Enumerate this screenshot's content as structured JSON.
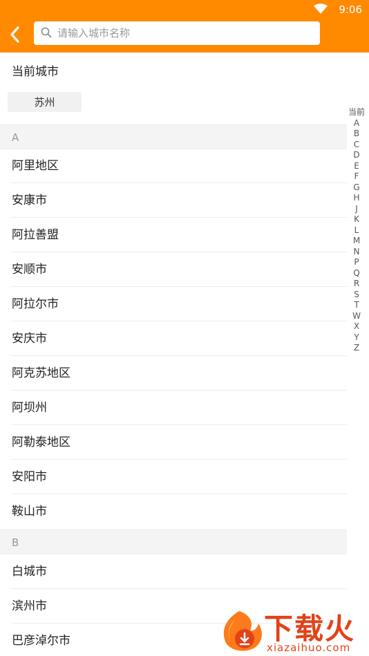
{
  "status_bar": {
    "time": "9:06",
    "wifi_icon": "wifi-icon"
  },
  "header": {
    "back_icon": "chevron-left-icon",
    "search": {
      "icon": "search-icon",
      "placeholder": "请输入城市名称",
      "value": ""
    },
    "background_color": "#ff8a00"
  },
  "current_city": {
    "label": "当前城市",
    "city": "苏州"
  },
  "groups": [
    {
      "letter": "A",
      "cities": [
        "阿里地区",
        "安康市",
        "阿拉善盟",
        "安顺市",
        "阿拉尔市",
        "安庆市",
        "阿克苏地区",
        "阿坝州",
        "阿勒泰地区",
        "安阳市",
        "鞍山市"
      ]
    },
    {
      "letter": "B",
      "cities": [
        "白城市",
        "滨州市",
        "巴彦淖尔市"
      ]
    }
  ],
  "index_bar": [
    "当前",
    "A",
    "B",
    "C",
    "D",
    "E",
    "F",
    "G",
    "H",
    "J",
    "K",
    "L",
    "M",
    "N",
    "P",
    "Q",
    "R",
    "S",
    "T",
    "W",
    "X",
    "Y",
    "Z"
  ],
  "watermark": {
    "title": "下载火",
    "url": "xiazaihuo.com",
    "color": "#e2421a"
  }
}
